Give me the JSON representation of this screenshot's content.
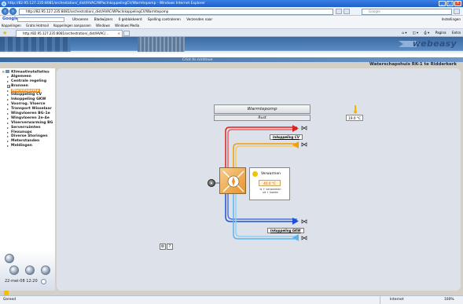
{
  "window": {
    "title": "http://82.95.127.235:8081/orchestation/_dist/HVAC/WPacInkoppelingCV/Warmtepomp - Windows Internet Explorer"
  },
  "address": {
    "url": "http://82.95.127.235:8081/orchestration/_dist/HVAC/WPacInkoppelingCV/Warmtepomp",
    "search_placeholder": "Google"
  },
  "google_toolbar": {
    "logo": "Google",
    "items": [
      "Uitvoeren",
      "Bladwijzers",
      "0 geblokkeerd",
      "Spelling controleren",
      "Verzenden naar"
    ],
    "settings": "Instellingen"
  },
  "links_bar": {
    "items": [
      "Koppelingen",
      "Gratis Hotmail",
      "Koppelingen aanpassen",
      "Windows",
      "Windows Media"
    ]
  },
  "tab": {
    "label": "http://82.95.127.235:8081/orchestration/_dist/HVAC/..."
  },
  "commands": [
    "Pagina",
    "Extra"
  ],
  "header": {
    "click_to_continue": "Click to continue",
    "logo": "webeasy",
    "location": "Waterschapshuis RK-1 te Ridderkerk"
  },
  "tree": {
    "root": "Klimaatinstallaties",
    "items": [
      {
        "label": "Algemeen",
        "selected": false,
        "expander": false
      },
      {
        "label": "Centrale regeling",
        "selected": false,
        "expander": false
      },
      {
        "label": "Bronnen",
        "selected": false,
        "expander": true
      },
      {
        "label": "Warmtepomp",
        "selected": true,
        "expander": false
      },
      {
        "label": "Inkoppeling CV",
        "selected": false,
        "expander": false
      },
      {
        "label": "Inkoppeling GKW",
        "selected": false,
        "expander": false
      },
      {
        "label": "Voorrog. Vloerce",
        "selected": false,
        "expander": false
      },
      {
        "label": "Transport Wisselaar",
        "selected": false,
        "expander": false
      },
      {
        "label": "Wingvloeren BG-1e",
        "selected": false,
        "expander": false
      },
      {
        "label": "Wingvloeren 2e-4e",
        "selected": false,
        "expander": false
      },
      {
        "label": "Vloerverwarming BG",
        "selected": false,
        "expander": false
      },
      {
        "label": "Serverruimten",
        "selected": false,
        "expander": false
      },
      {
        "label": "Flexunups",
        "selected": false,
        "expander": false
      },
      {
        "label": "Diverse Storingen",
        "selected": false,
        "expander": false
      },
      {
        "label": "Meterstanden",
        "selected": false,
        "expander": false
      },
      {
        "label": "Meldingen",
        "selected": false,
        "expander": false
      }
    ]
  },
  "sidebar_footer": {
    "datetime": "22-mei-08 12:20"
  },
  "main": {
    "title_button": "Warmtepomp",
    "status_button": "Rust",
    "outdoor_temp": "19.0 °C",
    "pump_panel": {
      "label": "Verwarmen",
      "value": "40.0 °C",
      "note": "Is + verwarmen\nuit + koelen"
    },
    "circuit_cv": "Inkoppeling CV",
    "circuit_gkw": "Inkoppeling GKW",
    "help_button": "?"
  },
  "statusbar": {
    "left": "Gereed",
    "zone": "Internet",
    "zoom": "100%"
  },
  "colors": {
    "hot": "#e02020",
    "warm": "#f2a000",
    "cold": "#1f4fd8",
    "cool": "#5ab4f0",
    "selected": "#f08b18"
  }
}
